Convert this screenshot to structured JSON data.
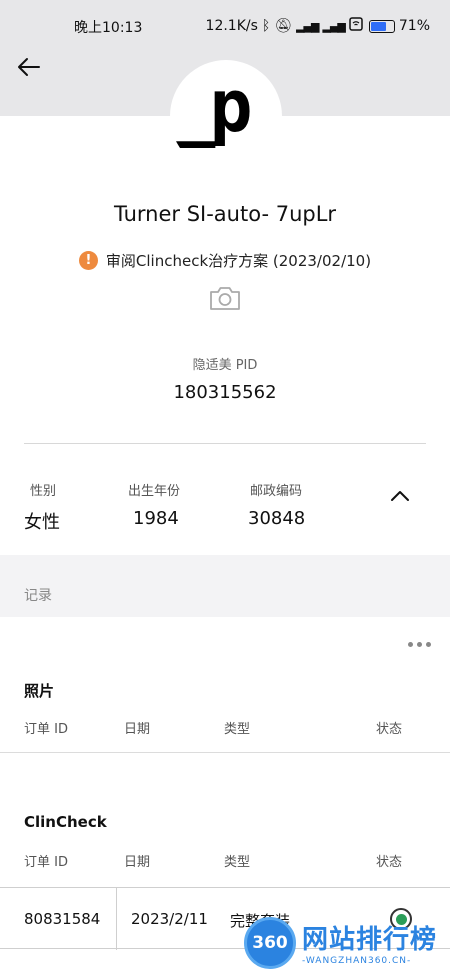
{
  "status_bar": {
    "time": "晚上10:13",
    "net_speed": "12.1K/s",
    "battery": "71%",
    "battery_level": 0.71,
    "icons": [
      "bluetooth-icon",
      "mute-icon",
      "signal-icon",
      "signal-icon",
      "wifi-icon",
      "battery-icon"
    ]
  },
  "header": {
    "back_icon": "arrow-left-icon"
  },
  "avatar": {
    "text": "_p"
  },
  "patient": {
    "name": "Turner SI-auto- 7upLr",
    "status_icon": "warning-icon",
    "status_text": "审阅Clincheck治疗方案 (2023/02/10)",
    "camera_icon": "camera-icon",
    "pid_label": "隐适美 PID",
    "pid_value": "180315562"
  },
  "info": {
    "gender_label": "性别",
    "gender_value": "女性",
    "birth_label": "出生年份",
    "birth_value": "1984",
    "zip_label": "邮政编码",
    "zip_value": "30848",
    "collapse_icon": "chevron-up-icon"
  },
  "records": {
    "section_label": "记录",
    "more_icon": "more-dots-icon",
    "photos": {
      "title": "照片",
      "columns": [
        "订单 ID",
        "日期",
        "类型",
        "状态"
      ]
    },
    "clincheck": {
      "title": "ClinCheck",
      "columns": [
        "订单 ID",
        "日期",
        "类型",
        "状态"
      ],
      "rows": [
        {
          "order_id": "80831584",
          "date": "2023/2/11",
          "type": "完整套装",
          "status_icon": "status-complete-icon",
          "status_color": "#2a9d58"
        }
      ]
    }
  },
  "watermark": {
    "badge": "360",
    "title": "网站排行榜",
    "subtitle": "-WANGZHAN360.CN-"
  }
}
